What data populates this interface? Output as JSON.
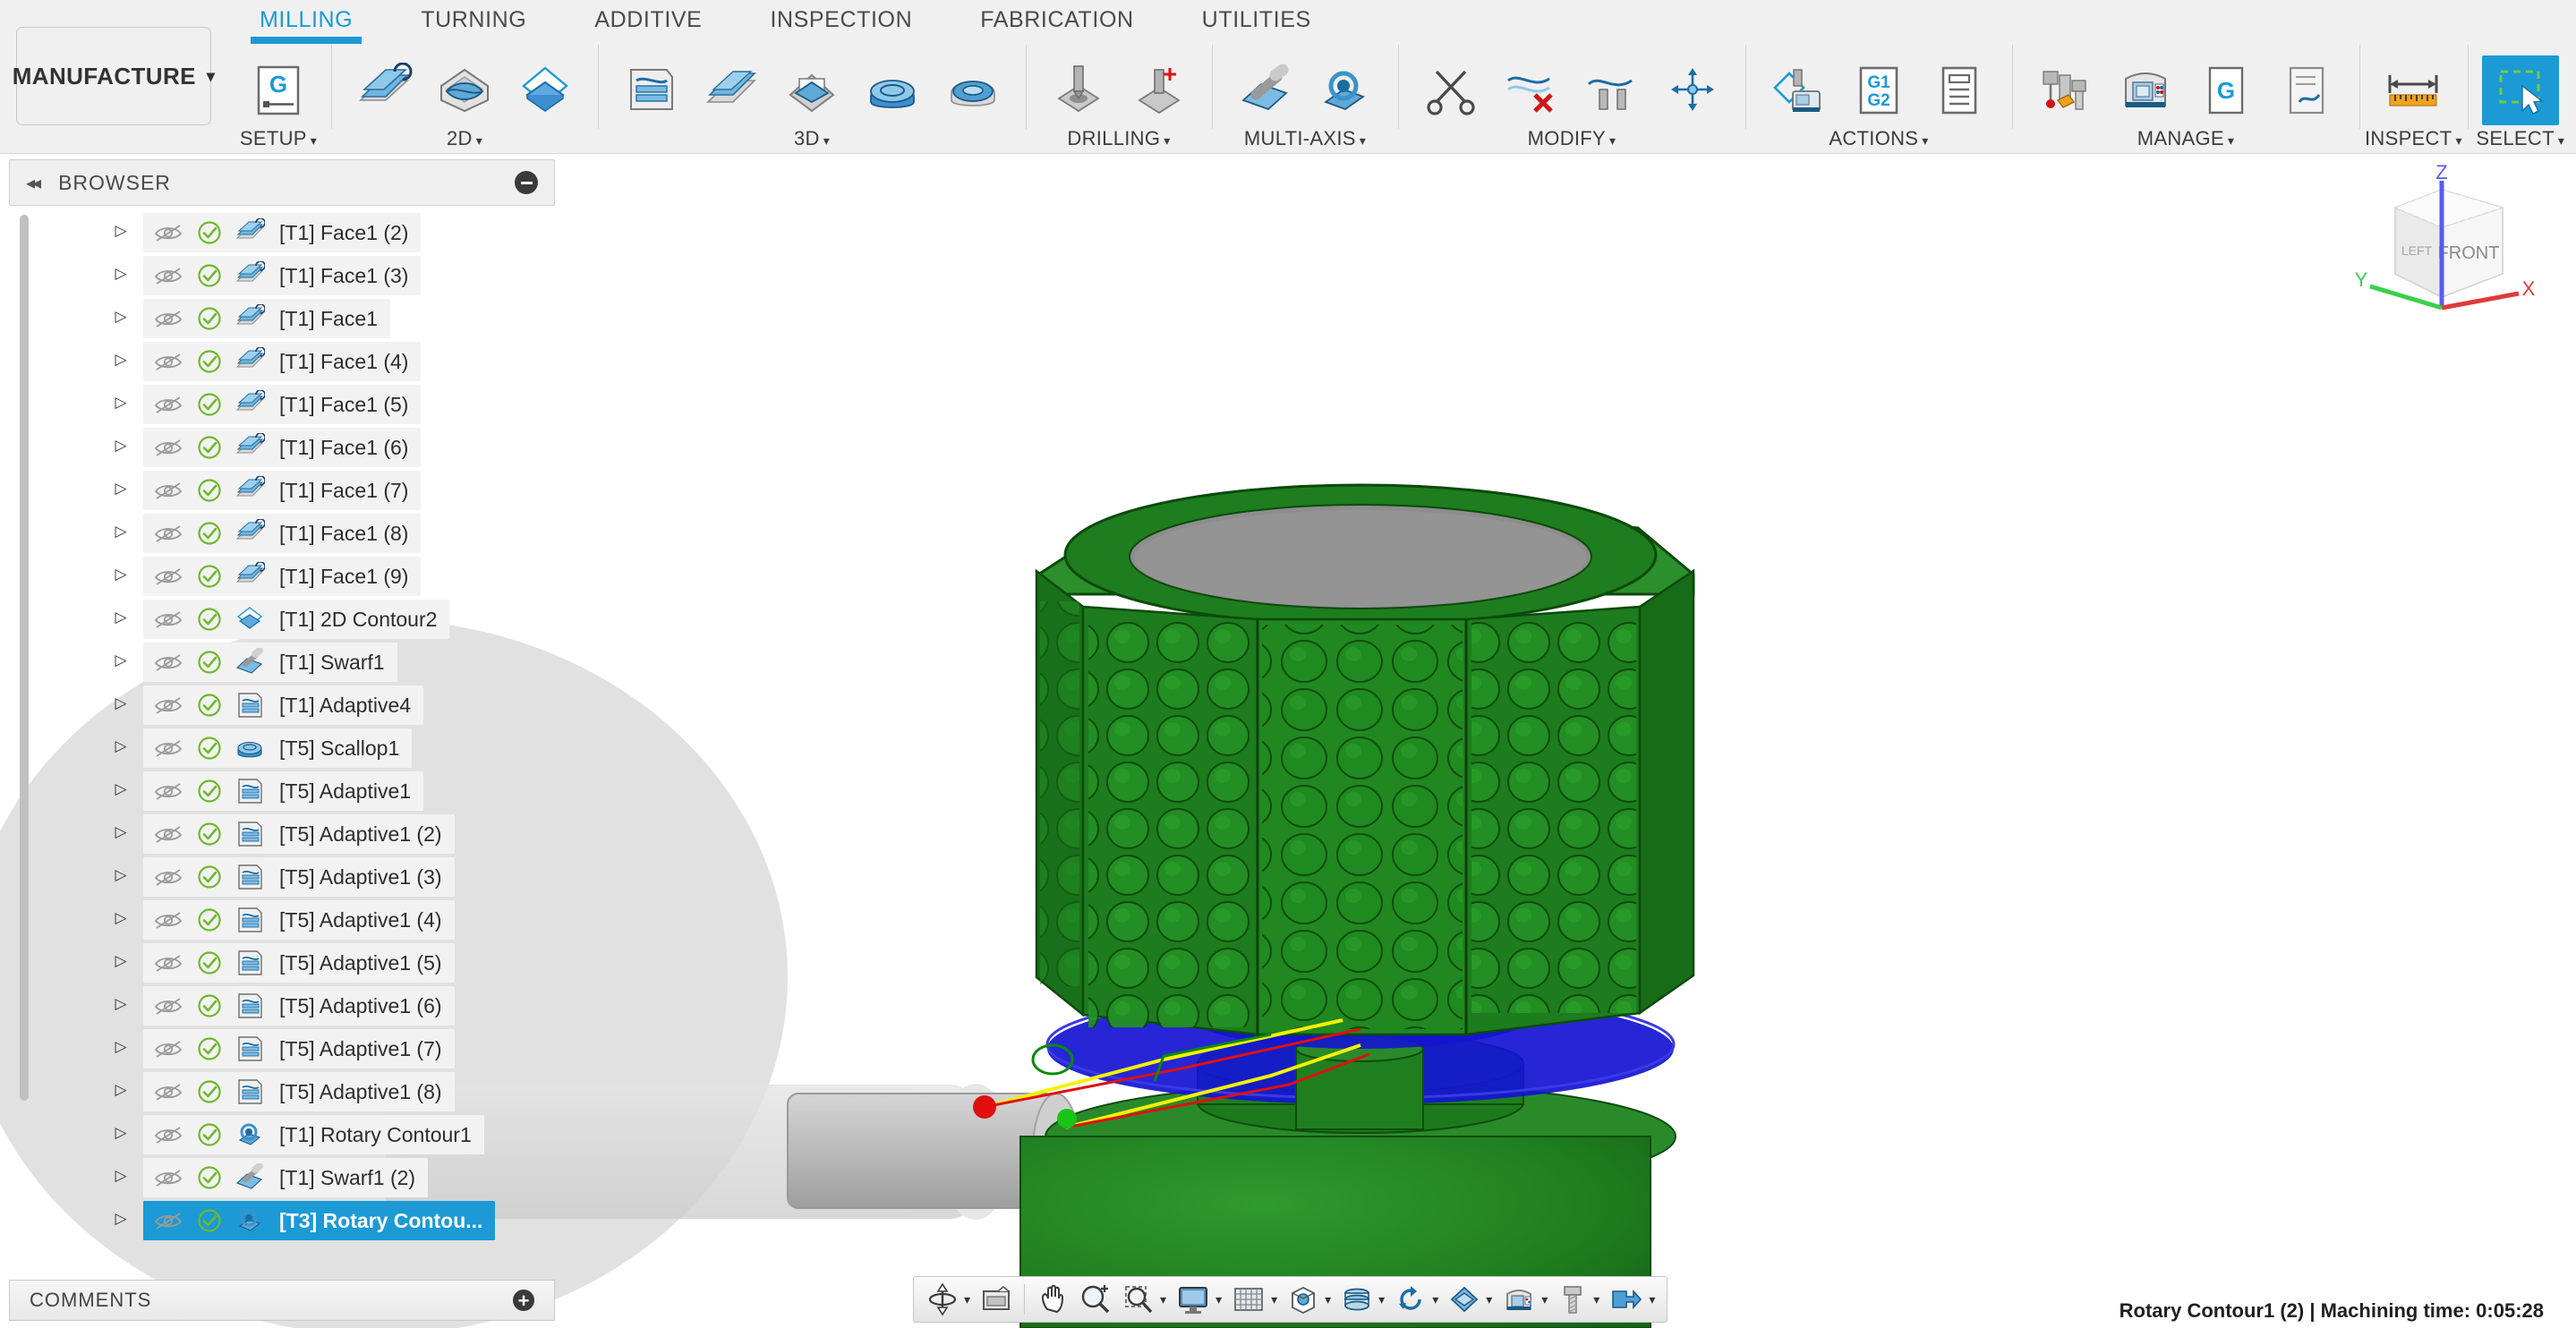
{
  "app": {
    "workspace": "MANUFACTURE",
    "workspace_caret": "▾"
  },
  "tabs": [
    {
      "label": "MILLING",
      "active": true
    },
    {
      "label": "TURNING",
      "active": false
    },
    {
      "label": "ADDITIVE",
      "active": false
    },
    {
      "label": "INSPECTION",
      "active": false
    },
    {
      "label": "FABRICATION",
      "active": false
    },
    {
      "label": "UTILITIES",
      "active": false
    }
  ],
  "ribbon_groups": [
    {
      "label": "SETUP",
      "caret": "▾",
      "icons": [
        "setup-g-icon"
      ]
    },
    {
      "label": "2D",
      "caret": "▾",
      "icons": [
        "face-icon",
        "adaptive2d-icon",
        "contour2d-icon"
      ]
    },
    {
      "label": "3D",
      "caret": "▾",
      "icons": [
        "adaptive3d-icon",
        "parallel-icon",
        "pocket3d-icon",
        "scallop-icon",
        "radial-icon"
      ]
    },
    {
      "label": "DRILLING",
      "caret": "▾",
      "icons": [
        "drill-icon",
        "thread-icon"
      ]
    },
    {
      "label": "MULTI-AXIS",
      "caret": "▾",
      "icons": [
        "swarf-icon",
        "rotary-icon"
      ]
    },
    {
      "label": "MODIFY",
      "caret": "▾",
      "icons": [
        "scissors-icon",
        "delete-toolpath-icon",
        "toolpath-icon",
        "transform-icon"
      ]
    },
    {
      "label": "ACTIONS",
      "caret": "▾",
      "icons": [
        "simulate-icon",
        "g1g2-post-icon",
        "setup-sheet-icon"
      ]
    },
    {
      "label": "MANAGE",
      "caret": "▾",
      "icons": [
        "tool-library-icon",
        "machine-library-icon",
        "generate-icon",
        "nc-program-icon"
      ]
    },
    {
      "label": "INSPECT",
      "caret": "▾",
      "icons": [
        "measure-icon"
      ]
    },
    {
      "label": "SELECT",
      "caret": "▾",
      "icons": [
        "select-window-icon"
      ]
    }
  ],
  "browser": {
    "title": "BROWSER",
    "collapse_arrows": "◂◂",
    "collapse_icon": "minimize-icon",
    "items": [
      {
        "label": "[T1] Face1 (2)",
        "icon": "face-op-icon",
        "selected": false
      },
      {
        "label": "[T1] Face1 (3)",
        "icon": "face-op-icon",
        "selected": false
      },
      {
        "label": "[T1] Face1",
        "icon": "face-op-icon",
        "selected": false
      },
      {
        "label": "[T1] Face1 (4)",
        "icon": "face-op-icon",
        "selected": false
      },
      {
        "label": "[T1] Face1 (5)",
        "icon": "face-op-icon",
        "selected": false
      },
      {
        "label": "[T1] Face1 (6)",
        "icon": "face-op-icon",
        "selected": false
      },
      {
        "label": "[T1] Face1 (7)",
        "icon": "face-op-icon",
        "selected": false
      },
      {
        "label": "[T1] Face1 (8)",
        "icon": "face-op-icon",
        "selected": false
      },
      {
        "label": "[T1] Face1 (9)",
        "icon": "face-op-icon",
        "selected": false
      },
      {
        "label": "[T1] 2D Contour2",
        "icon": "contour-op-icon",
        "selected": false
      },
      {
        "label": "[T1] Swarf1",
        "icon": "swarf-op-icon",
        "selected": false
      },
      {
        "label": "[T1] Adaptive4",
        "icon": "adaptive-op-icon",
        "selected": false
      },
      {
        "label": "[T5] Scallop1",
        "icon": "scallop-op-icon",
        "selected": false
      },
      {
        "label": "[T5] Adaptive1",
        "icon": "adaptive-op-icon",
        "selected": false
      },
      {
        "label": "[T5] Adaptive1 (2)",
        "icon": "adaptive-op-icon",
        "selected": false
      },
      {
        "label": "[T5] Adaptive1 (3)",
        "icon": "adaptive-op-icon",
        "selected": false
      },
      {
        "label": "[T5] Adaptive1 (4)",
        "icon": "adaptive-op-icon",
        "selected": false
      },
      {
        "label": "[T5] Adaptive1 (5)",
        "icon": "adaptive-op-icon",
        "selected": false
      },
      {
        "label": "[T5] Adaptive1 (6)",
        "icon": "adaptive-op-icon",
        "selected": false
      },
      {
        "label": "[T5] Adaptive1 (7)",
        "icon": "adaptive-op-icon",
        "selected": false
      },
      {
        "label": "[T5] Adaptive1 (8)",
        "icon": "adaptive-op-icon",
        "selected": false
      },
      {
        "label": "[T1] Rotary Contour1",
        "icon": "rotary-op-icon",
        "selected": false
      },
      {
        "label": "[T1] Swarf1 (2)",
        "icon": "swarf-op-icon",
        "selected": false
      },
      {
        "label": "[T3] Rotary Contou...",
        "icon": "rotary-op-icon",
        "selected": true
      }
    ]
  },
  "comments": {
    "title": "COMMENTS",
    "add_icon": "plus-icon"
  },
  "navbar": {
    "buttons": [
      {
        "name": "orbit-icon",
        "caret": "▾"
      },
      {
        "name": "view-extents-icon",
        "caret": ""
      },
      {
        "name": "pan-icon",
        "caret": ""
      },
      {
        "name": "zoom-icon",
        "caret": ""
      },
      {
        "name": "zoom-window-icon",
        "caret": "▾"
      },
      {
        "name": "display-settings-icon",
        "caret": "▾"
      },
      {
        "name": "grid-snaps-icon",
        "caret": "▾"
      },
      {
        "name": "viewports-icon",
        "caret": "▾"
      },
      {
        "name": "stock-visibility-icon",
        "caret": "▾"
      },
      {
        "name": "simulation-icon",
        "caret": "▾"
      },
      {
        "name": "toolpath-visibility-icon",
        "caret": "▾"
      },
      {
        "name": "machine-visibility-icon",
        "caret": "▾"
      },
      {
        "name": "tool-visibility-icon",
        "caret": "▾"
      },
      {
        "name": "fixture-visibility-icon",
        "caret": "▾"
      }
    ]
  },
  "viewcube": {
    "front_face": "FRONT",
    "left_face": "LEFT",
    "axis_z": "Z",
    "axis_x": "X",
    "axis_y": "Y"
  },
  "status": {
    "text": "Rotary Contour1 (2) | Machining time: 0:05:28"
  },
  "colors": {
    "accent": "#1b9ad6",
    "part_green": "#1f7a1f",
    "toolpath_blue": "#1414d2",
    "lead_red": "#e01010",
    "feed_yellow": "#f0f000",
    "check_green": "#6fb82c"
  }
}
